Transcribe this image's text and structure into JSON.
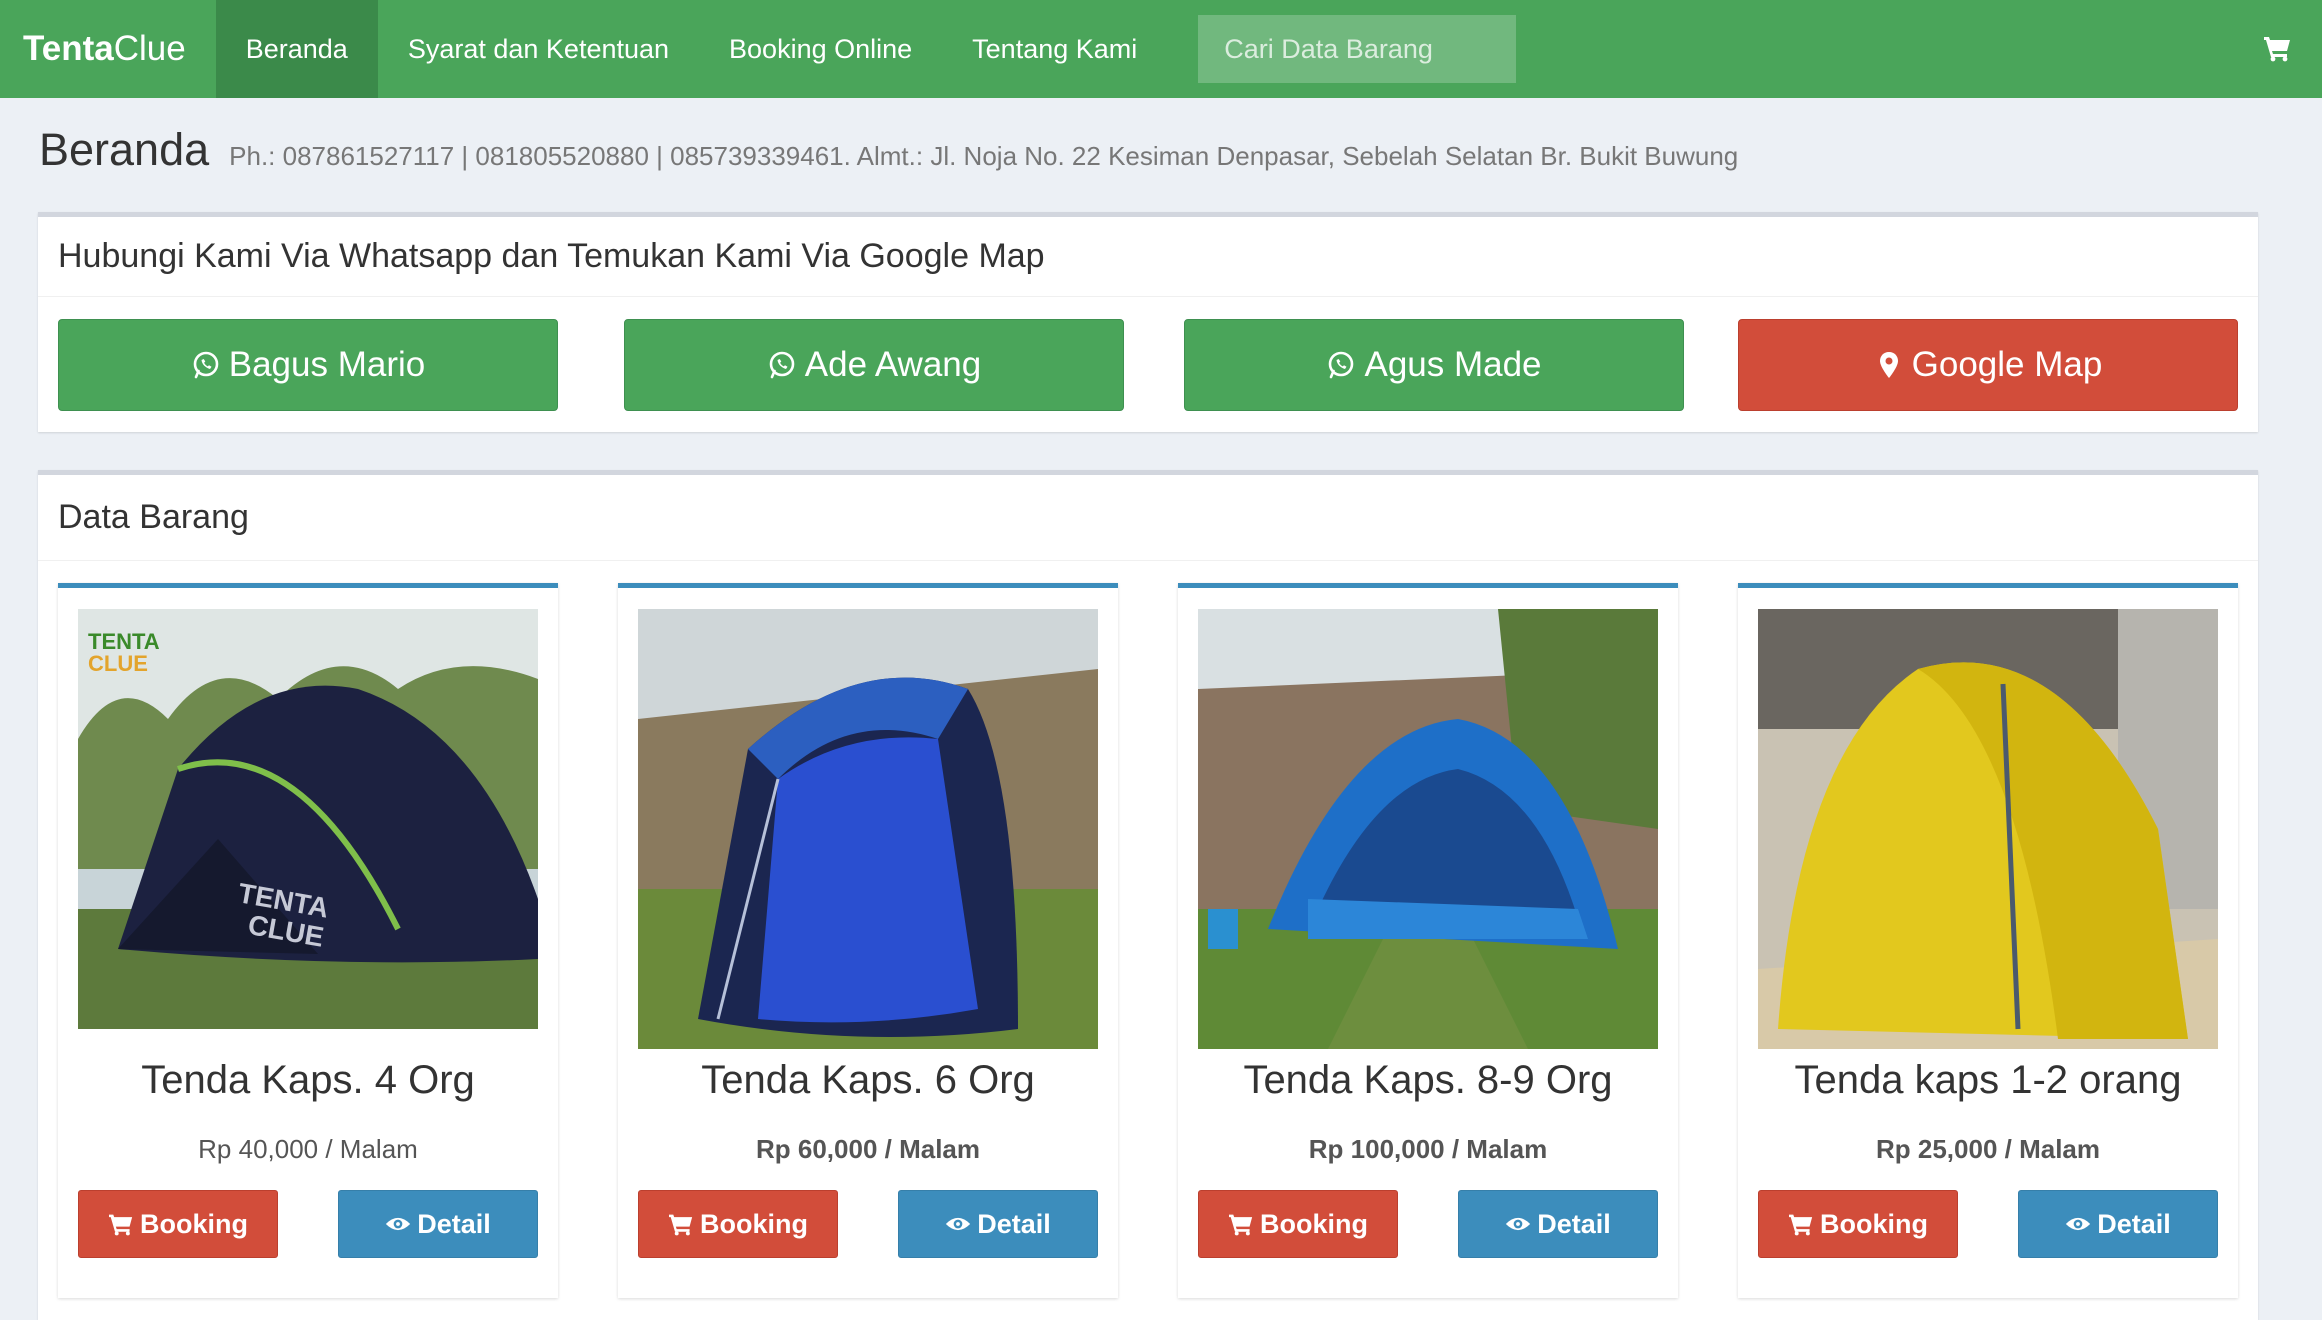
{
  "navbar": {
    "brand_bold": "Tenta",
    "brand_light": "Clue",
    "items": [
      {
        "label": "Beranda"
      },
      {
        "label": "Syarat dan Ketentuan"
      },
      {
        "label": "Booking Online"
      },
      {
        "label": "Tentang Kami"
      }
    ],
    "search_placeholder": "Cari Data Barang",
    "cart_icon": "shopping-cart-icon"
  },
  "header": {
    "title": "Beranda",
    "subtitle": "Ph.: 087861527117 | 081805520880 | 085739339461. Almt.: Jl. Noja No. 22 Kesiman Denpasar, Sebelah Selatan Br. Bukit Buwung"
  },
  "contact": {
    "title": "Hubungi Kami Via Whatsapp dan Temukan Kami Via Google Map",
    "buttons": [
      {
        "label": "Bagus Mario",
        "icon": "whatsapp-icon",
        "color": "#4aa55a"
      },
      {
        "label": "Ade Awang",
        "icon": "whatsapp-icon",
        "color": "#4aa55a"
      },
      {
        "label": "Agus Made",
        "icon": "whatsapp-icon",
        "color": "#4aa55a"
      },
      {
        "label": "Google Map",
        "icon": "map-marker-icon",
        "color": "#d24d3a"
      }
    ]
  },
  "products": {
    "title": "Data Barang",
    "items": [
      {
        "name": "Tenda Kaps. 4 Org",
        "price": "Rp 40,000 / Malam",
        "booking_label": "Booking",
        "detail_label": "Detail"
      },
      {
        "name": "Tenda Kaps. 6 Org",
        "price": "Rp 60,000 / Malam",
        "booking_label": "Booking",
        "detail_label": "Detail"
      },
      {
        "name": "Tenda Kaps. 8-9 Org",
        "price": "Rp 100,000 / Malam",
        "booking_label": "Booking",
        "detail_label": "Detail"
      },
      {
        "name": "Tenda kaps 1-2 orang",
        "price": "Rp 25,000 / Malam",
        "booking_label": "Booking",
        "detail_label": "Detail"
      }
    ]
  },
  "colors": {
    "primary_green": "#4aa55a",
    "danger_red": "#d24d3a",
    "info_blue": "#3c8dbc",
    "background": "#ecf0f5"
  }
}
